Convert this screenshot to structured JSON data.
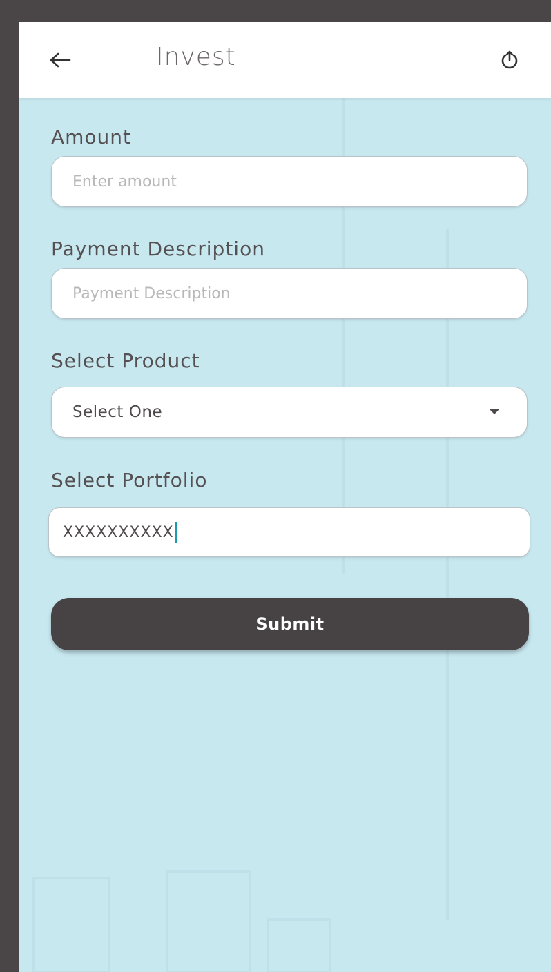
{
  "app": {
    "title": "Invest"
  },
  "header": {
    "back_icon": "arrow-left-icon",
    "logout_icon": "power-icon"
  },
  "form": {
    "amount": {
      "label": "Amount",
      "value": "",
      "placeholder": "Enter amount"
    },
    "payment_description": {
      "label": "Payment Description",
      "value": "",
      "placeholder": "Payment Description"
    },
    "product": {
      "label": "Select Product",
      "selected": "Select One"
    },
    "portfolio": {
      "label": "Select Portfolio",
      "value": "XXXXXXXXXX"
    },
    "submit_label": "Submit"
  },
  "colors": {
    "background": "#c8e8f0",
    "appbar": "#ffffff",
    "frame": "#4a4546",
    "button": "#474244",
    "cursor": "#1a9bb0"
  }
}
